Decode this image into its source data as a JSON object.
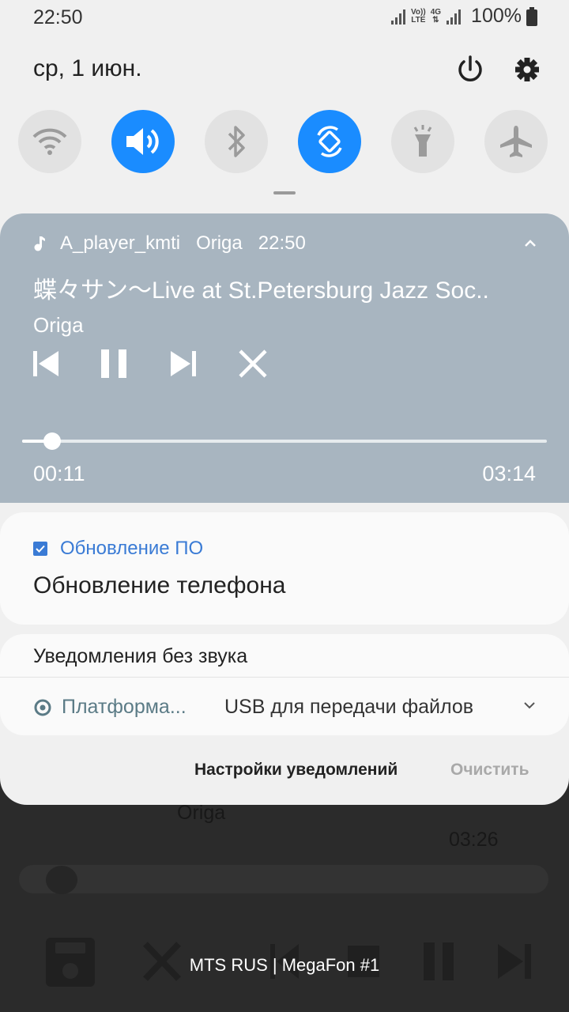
{
  "status_bar": {
    "time": "22:50",
    "network_volte": "Vo))",
    "network_lte": "LTE",
    "network_4g": "4G",
    "battery_percent": "100%"
  },
  "panel": {
    "date": "ср, 1 июн.",
    "quick_settings": [
      {
        "name": "wifi",
        "active": false
      },
      {
        "name": "sound",
        "active": true
      },
      {
        "name": "bluetooth",
        "active": false
      },
      {
        "name": "auto-rotate",
        "active": true
      },
      {
        "name": "flashlight",
        "active": false
      },
      {
        "name": "airplane-mode",
        "active": false
      }
    ]
  },
  "media": {
    "app": "A_player_kmti",
    "artist_header": "Origa",
    "time": "22:50",
    "title": "蝶々サン〜Live at St.Petersburg Jazz Soc..",
    "artist": "Origa",
    "elapsed": "00:11",
    "duration": "03:14",
    "progress": 0.057
  },
  "notification_update": {
    "app": "Обновление ПО",
    "text": "Обновление телефона"
  },
  "silent": {
    "header": "Уведомления без звука",
    "app": "Платформа...",
    "message": "USB для передачи файлов"
  },
  "actions": {
    "settings": "Настройки уведомлений",
    "clear": "Очистить"
  },
  "background": {
    "artist": "Origa",
    "time": "03:26",
    "carrier": "MTS RUS | MegaFon #1"
  },
  "colors": {
    "accent": "#1a8cff",
    "media_bg": "#a8b5c0",
    "link": "#3a7bd5"
  }
}
